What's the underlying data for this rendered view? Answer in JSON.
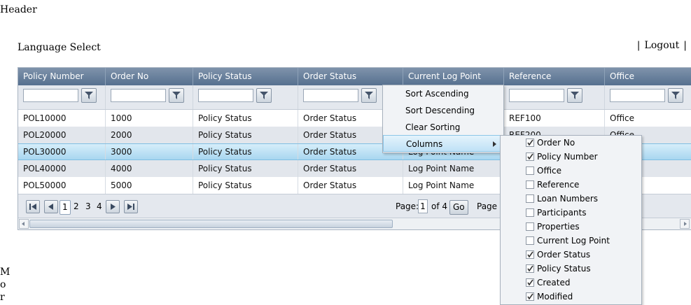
{
  "page": {
    "header": "Header",
    "language_select": "Language Select",
    "separator": "|",
    "logout": "Logout",
    "more_letters": [
      "M",
      "o",
      "r"
    ]
  },
  "grid": {
    "columns": [
      "Policy Number",
      "Order No",
      "Policy Status",
      "Order Status",
      "Current Log Point",
      "Reference",
      "Office"
    ],
    "rows": [
      [
        "POL10000",
        "1000",
        "Policy Status",
        "Order Status",
        "",
        "REF100",
        "Office"
      ],
      [
        "POL20000",
        "2000",
        "Policy Status",
        "Order Status",
        "",
        "REF200",
        "Office"
      ],
      [
        "POL30000",
        "3000",
        "Policy Status",
        "Order Status",
        "Log Point Name",
        "",
        ""
      ],
      [
        "POL40000",
        "4000",
        "Policy Status",
        "Order Status",
        "Log Point Name",
        "",
        ""
      ],
      [
        "POL50000",
        "5000",
        "Policy Status",
        "Order Status",
        "Log Point Name",
        "",
        ""
      ]
    ],
    "selected_row": 2,
    "pager": {
      "pages": [
        "1",
        "2",
        "3",
        "4"
      ],
      "current_page": "1",
      "page_label": "Page:",
      "page_input": "1",
      "of_label": "of 4",
      "go_label": "Go",
      "page_size_label": "Page s"
    }
  },
  "context_menu": {
    "items": [
      "Sort Ascending",
      "Sort Descending",
      "Clear Sorting",
      "Columns"
    ],
    "active_item": "Columns"
  },
  "columns_menu": {
    "items": [
      {
        "label": "Order No",
        "checked": true
      },
      {
        "label": "Policy Number",
        "checked": true
      },
      {
        "label": "Office",
        "checked": false
      },
      {
        "label": "Reference",
        "checked": false
      },
      {
        "label": "Loan Numbers",
        "checked": false
      },
      {
        "label": "Participants",
        "checked": false
      },
      {
        "label": "Properties",
        "checked": false
      },
      {
        "label": "Current Log Point",
        "checked": false
      },
      {
        "label": "Order Status",
        "checked": true
      },
      {
        "label": "Policy Status",
        "checked": true
      },
      {
        "label": "Created",
        "checked": true
      },
      {
        "label": "Modified",
        "checked": true
      }
    ]
  }
}
